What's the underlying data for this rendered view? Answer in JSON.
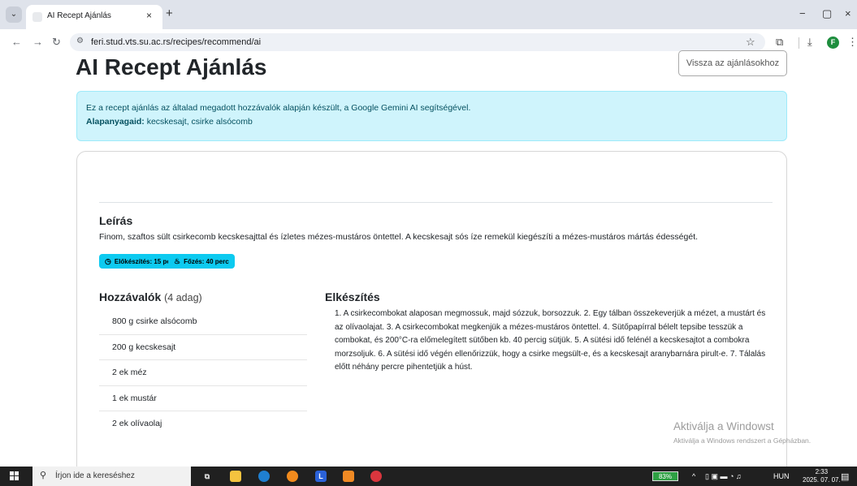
{
  "browser": {
    "tab_title": "AI Recept Ajánlás",
    "tab_close": "×",
    "new_tab": "+",
    "url": "feri.stud.vts.su.ac.rs/recipes/recommend/ai",
    "icons": [
      "tab-list-icon",
      "back-icon",
      "forward-icon",
      "reload-icon",
      "site-settings-icon",
      "star-icon",
      "extensions-icon",
      "download-icon",
      "profile-icon",
      "menu-icon"
    ],
    "profile_initial": "F",
    "window_controls": [
      "−",
      "▢",
      "×"
    ]
  },
  "page": {
    "title": "AI Recept Ajánlás",
    "back_button": "Vissza az ajánlásokhoz",
    "alert": {
      "line1": "Ez a recept ajánlás az általad megadott hozzávalók alapján készült, a Google Gemini AI segítségével.",
      "ingredients_label": "Alapanyagaid:",
      "ingredients_value": "kecskesajt, csirke alsócomb"
    },
    "description": {
      "heading": "Leírás",
      "text": "Finom, szaftos sült csirkecomb kecskesajttal és ízletes mézes-mustáros öntettel. A kecskesajt sós íze remekül kiegészíti a mézes-mustáros mártás édességét."
    },
    "badges": {
      "prep": "Előkészítés: 15 perc",
      "cook": "Főzés: 40 perc",
      "color": "#0dcaf0"
    },
    "ingredients": {
      "heading": "Hozzávalók",
      "portions": "(4 adag)",
      "items": [
        "800 g csirke alsócomb",
        "200 g kecskesajt",
        "2 ek méz",
        "1 ek mustár",
        "2 ek olívaolaj"
      ]
    },
    "preparation": {
      "heading": "Elkészítés",
      "text": "1. A csirkecombokat alaposan megmossuk, majd sózzuk, borsozzuk. 2. Egy tálban összekeverjük a mézet, a mustárt és az olívaolajat. 3. A csirkecombokat megkenjük a mézes-mustáros öntettel. 4. Sütőpapírral bélelt tepsibe tesszük a combokat, és 200°C-ra előmelegített sütőben kb. 40 percig sütjük. 5. A sütési idő felénél a kecskesajtot a combokra morzsoljuk. 6. A sütési idő végén ellenőrizzük, hogy a csirke megsült-e, és a kecskesajt aranybarnára pirult-e. 7. Tálalás előtt néhány percre pihentetjük a húst."
    },
    "watermark": {
      "line1": "Aktiválja a Windowst",
      "line2": "Aktiválja a Windows rendszert a Gépházban."
    }
  },
  "taskbar": {
    "search_placeholder": "Írjon ide a kereséshez",
    "battery": "83%",
    "language": "HUN",
    "time": "2:33",
    "date": "2025. 07. 07.",
    "notification_count": "2"
  }
}
